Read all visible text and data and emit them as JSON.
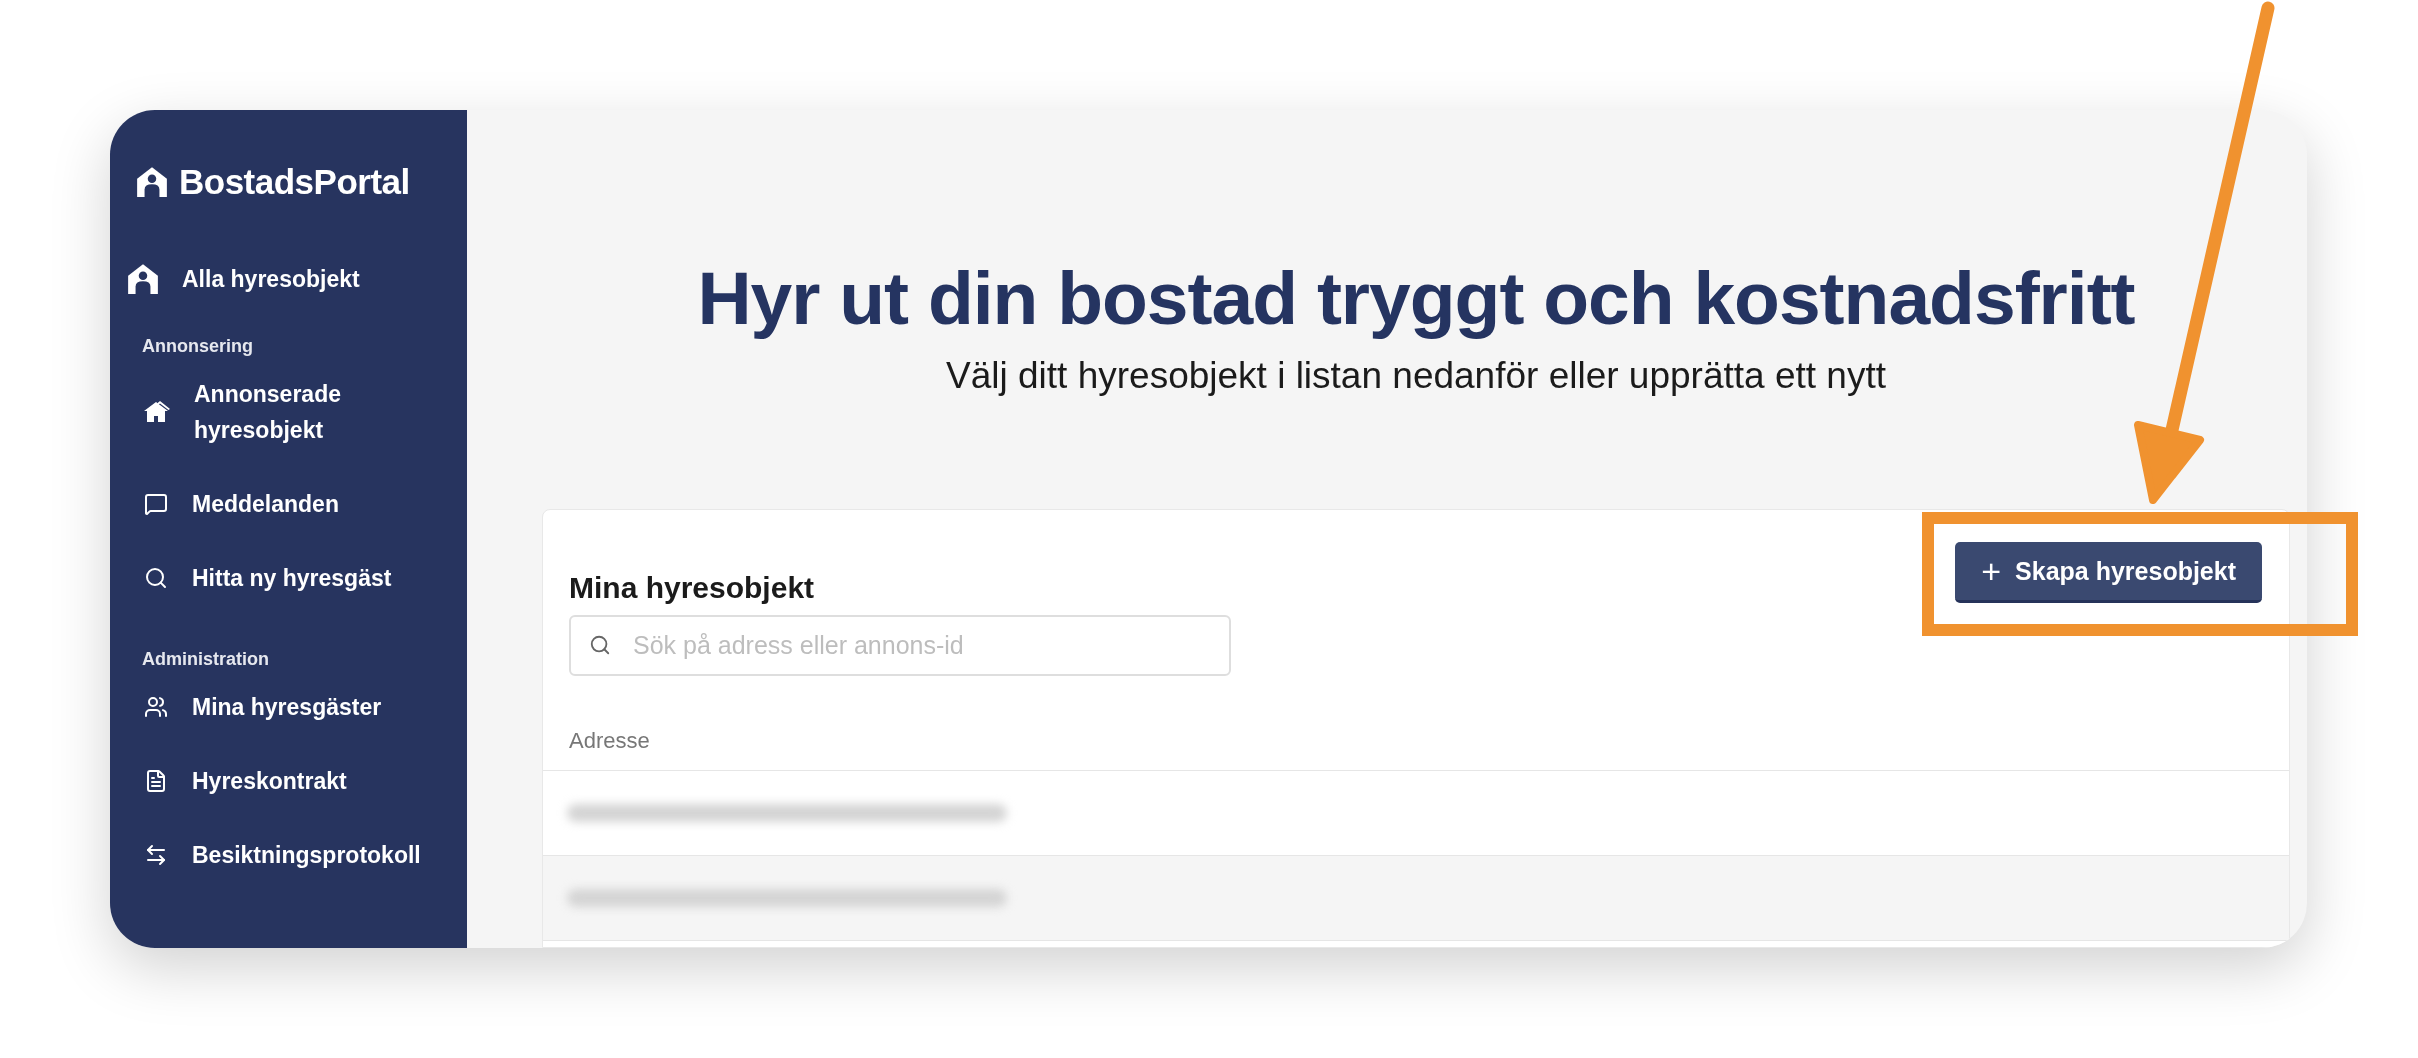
{
  "sidebar": {
    "logo": "BostadsPortal",
    "home_link": {
      "label": "Alla hyresobjekt"
    },
    "sections": [
      {
        "heading": "Annonsering",
        "items": [
          "Annonserade hyresobjekt",
          "Meddelanden",
          "Hitta ny hyresgäst"
        ]
      },
      {
        "heading": "Administration",
        "items": [
          "Mina hyresgäster",
          "Hyreskontrakt",
          "Besiktningsprotokoll"
        ]
      }
    ]
  },
  "header": {
    "title": "Hyr ut din bostad tryggt och kostnadsfritt",
    "subtitle": "Välj ditt hyresobjekt i listan nedanför eller upprätta ett nytt"
  },
  "card": {
    "title": "Mina hyresobjekt",
    "create_button": {
      "icon": "+",
      "label": "Skapa hyresobjekt"
    },
    "search": {
      "placeholder": "Sök på adress eller annons-id"
    },
    "table": {
      "columns": [
        "Adresse"
      ],
      "rows": [
        {
          "kind": "blurred"
        },
        {
          "kind": "blurred"
        }
      ]
    }
  }
}
